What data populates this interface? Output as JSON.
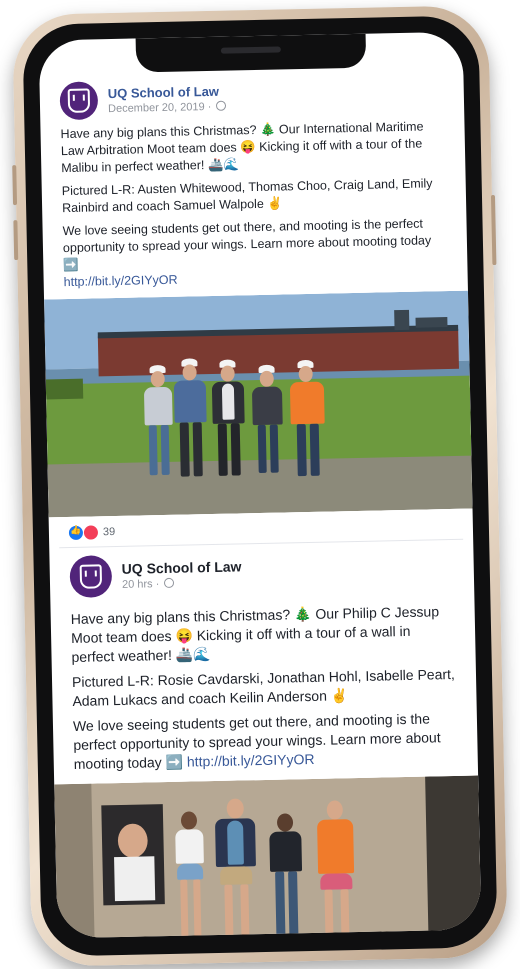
{
  "post1": {
    "page_name": "UQ School of Law",
    "date": "December 20, 2019 ·",
    "text1": "Have any big plans this Christmas? 🎄 Our International Maritime Law Arbitration Moot team does 😝 Kicking it off with a tour of the Malibu in perfect weather! 🚢🌊",
    "text2": "Pictured L-R: Austen Whitewood, Thomas Choo, Craig Land, Emily Rainbird and coach Samuel Walpole ✌️",
    "text3": "We love seeing students get out there, and mooting is the perfect opportunity to spread your wings. Learn more about mooting today ➡️",
    "link": "http://bit.ly/2GIYyOR",
    "reaction_count": "39"
  },
  "post2": {
    "page_name": "UQ School of Law",
    "time": "20 hrs ·",
    "text1": "Have any big plans this Christmas? 🎄 Our Philip C Jessup Moot team does 😝 Kicking it off with a tour of a wall in perfect weather! 🚢🌊",
    "text2": "Pictured L-R: Rosie Cavdarski, Jonathan Hohl, Isabelle Peart, Adam Lukacs and coach Keilin Anderson ✌️",
    "text3": "We love seeing students get out there, and mooting is the perfect opportunity to spread your wings. Learn more about mooting today ➡️",
    "link": "http://bit.ly/2GIYyOR"
  },
  "colors": {
    "brand_purple": "#51247a",
    "link_blue": "#385898",
    "like_blue": "#1877f2",
    "love_red": "#f33e58"
  },
  "icons": [
    "uq-crest-icon",
    "globe-icon",
    "like-reaction-icon",
    "love-reaction-icon"
  ]
}
